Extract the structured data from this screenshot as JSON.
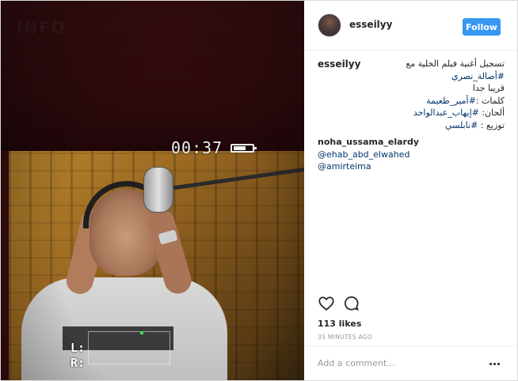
{
  "post": {
    "username": "esseilyy",
    "follow_label": "Follow",
    "media": {
      "timer": "00:37",
      "channel_labels": "L:\nR:",
      "ghost_text": "INFO"
    },
    "caption": {
      "user": "esseilyy",
      "lines": [
        [
          "تسجيل أغنية فيلم الخلية مع ",
          "#أصالة_نصري"
        ],
        [
          "قريبا جدا",
          ""
        ],
        [
          "كلمات :",
          "#أمير_طعيمة"
        ],
        [
          "ألحان: ",
          "#إيهاب_عبدالواحد"
        ],
        [
          "توزيع : ",
          "#نابلسي"
        ]
      ]
    },
    "comment": {
      "user": "noha_ussama_elardy",
      "mention1": "@ehab_abd_elwahed",
      "mention2": "@amirteima"
    },
    "likes": "113 likes",
    "time_ago": "35 MINUTES AGO",
    "add_comment_placeholder": "Add a comment..."
  },
  "icons": [
    "heart-icon",
    "comment-icon",
    "more-options-icon"
  ],
  "colors": {
    "follow_button": "#3897f0",
    "link": "#003569",
    "muted": "#999999"
  }
}
